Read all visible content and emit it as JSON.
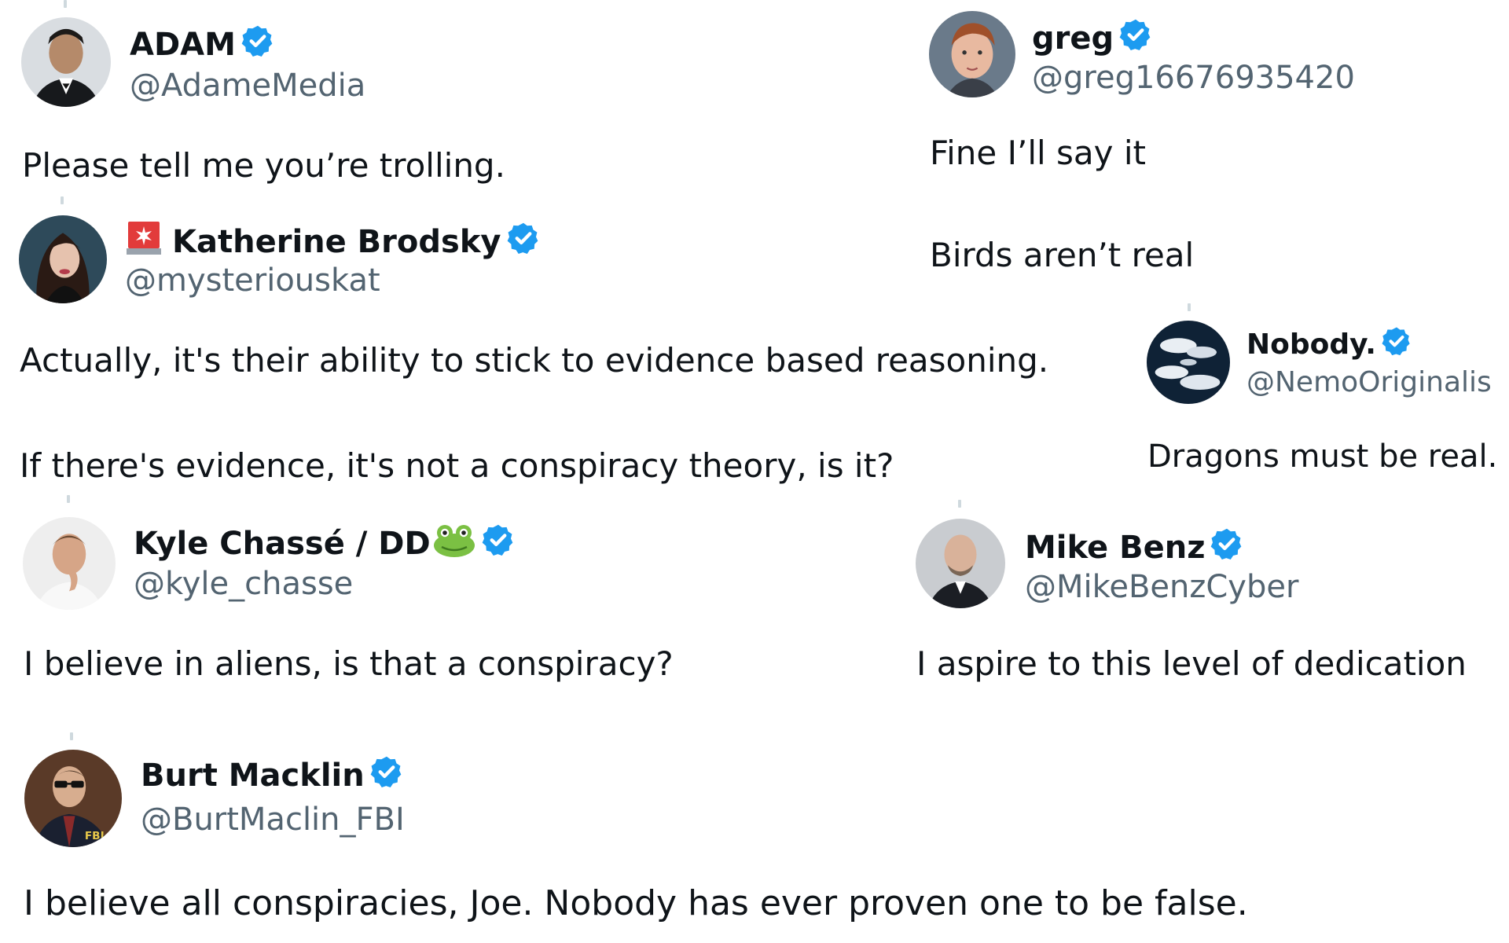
{
  "colors": {
    "verified": "#1d9bf0",
    "handle": "#536471",
    "text": "#0f1419",
    "divider": "#cfd9de"
  },
  "tweets": [
    {
      "name": "ADAM",
      "handle": "@AdameMedia",
      "lines": [
        "Please tell me you’re trolling."
      ],
      "verified": true,
      "avatar_icon": "avatar-man-suit"
    },
    {
      "name": "greg",
      "handle": "@greg16676935420",
      "lines": [
        "Fine I’ll say it",
        "Birds aren’t real"
      ],
      "verified": true,
      "avatar_icon": "avatar-red-hair"
    },
    {
      "name": "Katherine Brodsky",
      "name_prefix_icon": "siren-emoji",
      "handle": "@mysteriouskat",
      "lines": [
        "Actually, it's their ability to stick to evidence based reasoning.",
        "If there's evidence, it's not a conspiracy theory, is it?"
      ],
      "verified": true,
      "avatar_icon": "avatar-woman"
    },
    {
      "name": "Nobody.",
      "handle": "@NemoOriginalis",
      "lines": [
        "Dragons must be real."
      ],
      "verified": true,
      "avatar_icon": "avatar-clouds"
    },
    {
      "name": "Kyle Chassé / DD",
      "name_suffix_icon": "frog-emoji",
      "handle": "@kyle_chasse",
      "lines": [
        "I believe in aliens, is that a conspiracy?"
      ],
      "verified": true,
      "avatar_icon": "avatar-man-thinking"
    },
    {
      "name": "Mike Benz",
      "handle": "@MikeBenzCyber",
      "lines": [
        "I aspire to this level of dedication"
      ],
      "verified": true,
      "avatar_icon": "avatar-bald-man"
    },
    {
      "name": "Burt Macklin",
      "handle": "@BurtMaclin_FBI",
      "lines": [
        "I believe all conspiracies, Joe. Nobody has ever proven one to be false."
      ],
      "verified": true,
      "avatar_icon": "avatar-fbi-sunglasses"
    }
  ]
}
